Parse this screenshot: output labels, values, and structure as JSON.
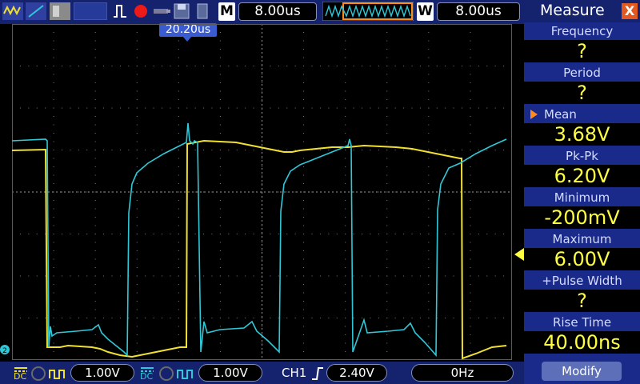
{
  "toolbar": {
    "time_mode_letter": "M",
    "timebase": "8.00us",
    "window_letter": "W",
    "window_timebase": "8.00us",
    "trigger_position": "20.20us"
  },
  "measure_panel": {
    "title": "Measure",
    "close_label": "X",
    "items": [
      {
        "label": "Frequency",
        "value": "?"
      },
      {
        "label": "Period",
        "value": "?"
      },
      {
        "label": "Mean",
        "value": "3.68V"
      },
      {
        "label": "Pk-Pk",
        "value": "6.20V"
      },
      {
        "label": "Minimum",
        "value": "-200mV"
      },
      {
        "label": "Maximum",
        "value": "6.00V"
      },
      {
        "label": "+Pulse Width",
        "value": "?"
      },
      {
        "label": "Rise Time",
        "value": "40.00ns"
      }
    ],
    "selected_index": 2,
    "modify_label": "Modify"
  },
  "bottom_bar": {
    "ch1_coupling": "DC",
    "ch1_scale": "1.00V",
    "ch2_coupling": "DC",
    "ch2_scale": "1.00V",
    "trigger_source": "CH1",
    "trigger_level": "2.40V",
    "frequency": "0Hz"
  },
  "colors": {
    "ch1": "#f0e030",
    "ch2": "#30c8d8",
    "accent": "#ff8a20",
    "panel_bg": "#1a2a8a"
  }
}
